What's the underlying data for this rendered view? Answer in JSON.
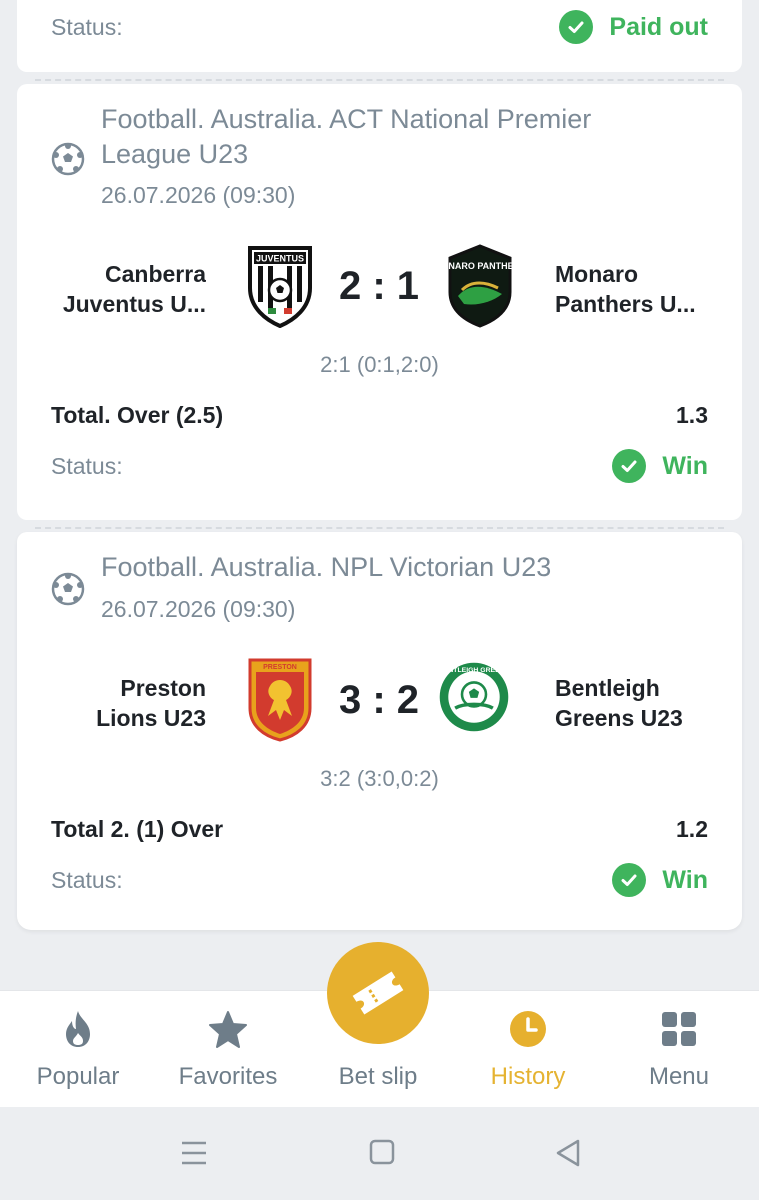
{
  "top_card": {
    "status_label": "Status:",
    "status_value": "Paid out"
  },
  "events": [
    {
      "league": "Football. Australia. ACT National Premier League U23",
      "datetime": "26.07.2026 (09:30)",
      "home_line1": "Canberra",
      "home_line2": "Juventus U...",
      "away_line1": "Monaro",
      "away_line2": "Panthers U...",
      "score": "2 : 1",
      "score_detail": "2:1 (0:1,2:0)",
      "market": "Total. Over (2.5)",
      "odds": "1.3",
      "status_label": "Status:",
      "status_value": "Win",
      "home_logo_text": "JUVENTUS",
      "away_logo_text": "MONARO PANTHERS"
    },
    {
      "league": "Football. Australia. NPL Victorian U23",
      "datetime": "26.07.2026 (09:30)",
      "home_line1": "Preston",
      "home_line2": "Lions U23",
      "away_line1": "Bentleigh",
      "away_line2": "Greens U23",
      "score": "3 : 2",
      "score_detail": "3:2 (3:0,0:2)",
      "market": "Total 2. (1) Over",
      "odds": "1.2",
      "status_label": "Status:",
      "status_value": "Win",
      "home_logo_text": "PRESTON",
      "away_logo_text": "BENTLEIGH GREENS"
    }
  ],
  "nav": {
    "popular": "Popular",
    "favorites": "Favorites",
    "betslip": "Bet slip",
    "history": "History",
    "menu": "Menu"
  },
  "colors": {
    "accent": "#e6b02e",
    "win": "#3fb45d",
    "muted": "#7c8a96",
    "text": "#1f2328",
    "background": "#eceef1"
  },
  "icons": [
    "soccer-ball-icon",
    "check-icon",
    "flame-icon",
    "star-icon",
    "ticket-icon",
    "clock-icon",
    "grid-icon",
    "recent-apps-icon",
    "home-icon",
    "back-icon"
  ]
}
